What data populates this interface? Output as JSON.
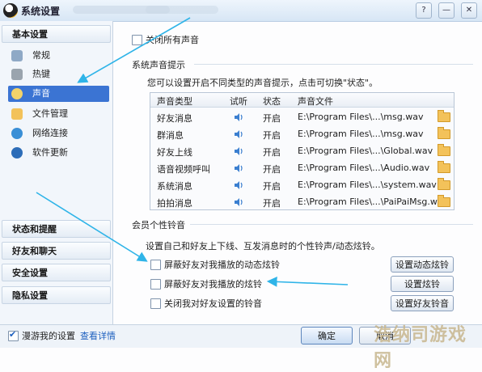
{
  "window": {
    "title": "系统设置",
    "titlebar_blur_text": "一切都在后台",
    "controls": [
      "?",
      "—",
      "✕"
    ]
  },
  "sidebar": {
    "categories_top": [
      {
        "label": "基本设置"
      }
    ],
    "items": [
      {
        "label": "常规",
        "icon": "general-icon"
      },
      {
        "label": "热键",
        "icon": "hotkey-icon"
      },
      {
        "label": "声音",
        "icon": "sound-icon",
        "selected": true
      },
      {
        "label": "文件管理",
        "icon": "folder-icon"
      },
      {
        "label": "网络连接",
        "icon": "network-icon"
      },
      {
        "label": "软件更新",
        "icon": "update-icon"
      }
    ],
    "categories_bottom": [
      {
        "label": "状态和提醒"
      },
      {
        "label": "好友和聊天"
      },
      {
        "label": "安全设置"
      },
      {
        "label": "隐私设置"
      }
    ]
  },
  "main": {
    "close_all_label": "关闭所有声音",
    "system_section_title": "系统声音提示",
    "system_desc": "您可以设置开启不同类型的声音提示，点击可切换\"状态\"。",
    "table": {
      "headers": [
        "声音类型",
        "试听",
        "状态",
        "声音文件"
      ],
      "rows": [
        {
          "type": "好友消息",
          "status": "开启",
          "file": "E:\\Program Files\\...\\msg.wav"
        },
        {
          "type": "群消息",
          "status": "开启",
          "file": "E:\\Program Files\\...\\msg.wav"
        },
        {
          "type": "好友上线",
          "status": "开启",
          "file": "E:\\Program Files\\...\\Global.wav"
        },
        {
          "type": "语音视频呼叫",
          "status": "开启",
          "file": "E:\\Program Files\\...\\Audio.wav"
        },
        {
          "type": "系统消息",
          "status": "开启",
          "file": "E:\\Program Files\\...\\system.wav"
        },
        {
          "type": "拍拍消息",
          "status": "开启",
          "file": "E:\\Program Files\\...\\PaiPaiMsg.wav"
        }
      ]
    },
    "member_section_title": "会员个性铃音",
    "member_desc": "设置自己和好友上下线、互发消息时的个性铃声/动态炫铃。",
    "options": [
      {
        "label": "屏蔽好友对我播放的动态炫铃",
        "button": "设置动态炫铃"
      },
      {
        "label": "屏蔽好友对我播放的炫铃",
        "button": "设置炫铃"
      },
      {
        "label": "关闭我对好友设置的铃音",
        "button": "设置好友铃音"
      }
    ]
  },
  "footer": {
    "roaming_label": "漫游我的设置",
    "details_link": "查看详情",
    "ok_label": "确定",
    "cancel_label": "取消",
    "watermark": "浩纳司游戏网"
  },
  "colors": {
    "selection": "#3b74d3",
    "annotation_arrow": "#2fb4e8",
    "folder": "#f3c25a"
  }
}
